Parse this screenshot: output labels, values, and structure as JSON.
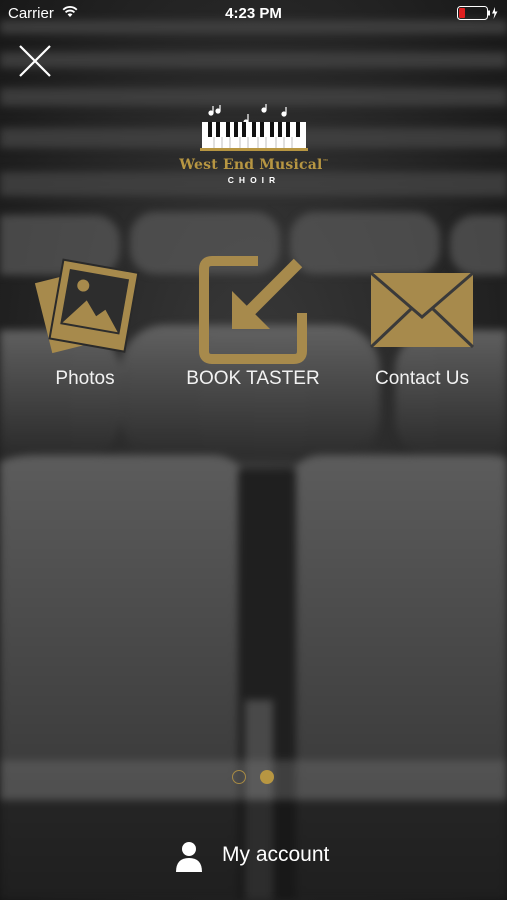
{
  "status_bar": {
    "carrier": "Carrier",
    "time": "4:23 PM"
  },
  "header": {
    "close_icon": "close-icon"
  },
  "logo": {
    "title": "West End Musical",
    "subtitle": "CHOIR",
    "trademark": "™"
  },
  "menu": [
    {
      "label": "Photos",
      "icon": "photos-icon"
    },
    {
      "label": "BOOK TASTER",
      "icon": "book-taster-icon"
    },
    {
      "label": "Contact Us",
      "icon": "mail-icon"
    }
  ],
  "pagination": {
    "pages": 2,
    "current": 2
  },
  "footer": {
    "account_label": "My account",
    "icon": "user-icon"
  },
  "colors": {
    "accent": "#b79642",
    "text": "#ffffff",
    "battery_low": "#e02020"
  }
}
